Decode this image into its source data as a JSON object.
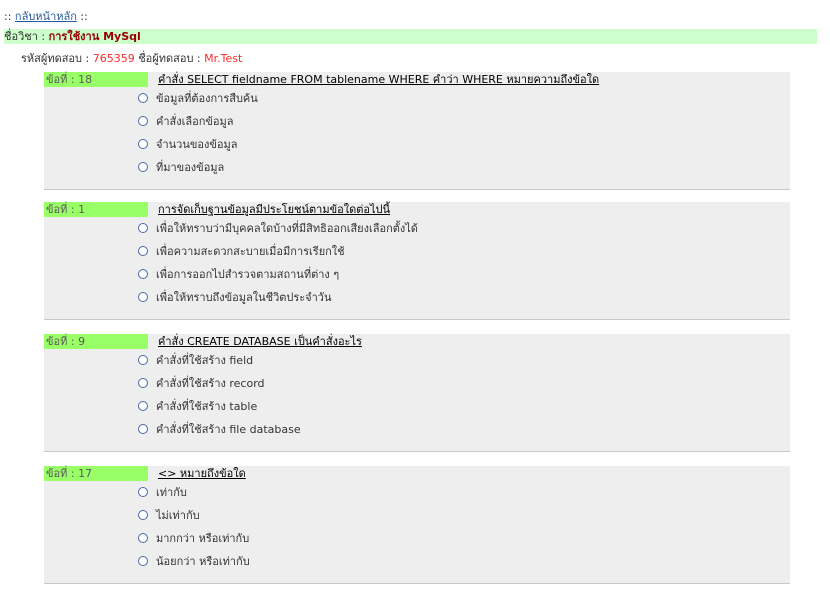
{
  "nav": {
    "prefix": ":: ",
    "home_link": "กลับหน้าหลัก",
    "suffix": " ::"
  },
  "subject": {
    "label": "ชื่อวิชา : ",
    "value": "การใช้งาน MySql"
  },
  "meta": {
    "code_label": "รหัสผู้ทดสอบ : ",
    "code_value": "765359",
    "name_label": " ชื่อผู้ทดสอบ : ",
    "name_value": "Mr.Test"
  },
  "questions": [
    {
      "num": "ข้อที่ : 18",
      "text": "คำสั่ง SELECT fieldname FROM tablename WHERE คำว่า WHERE หมายความถึงข้อใด",
      "choices": [
        "ข้อมูลที่ต้องการสืบค้น",
        "คำสั่งเลือกข้อมูล",
        "จำนวนของข้อมูล",
        "ที่มาของข้อมูล"
      ]
    },
    {
      "num": "ข้อที่ : 1",
      "text": "การจัดเก็บฐานข้อมูลมีประโยชน์ตามข้อใดต่อไปนี้",
      "choices": [
        "เพื่อให้ทราบว่ามีบุคคลใดบ้างที่มีสิทธิออกเสียงเลือกตั้งได้",
        "เพื่อความสะดวกสะบายเมื่อมีการเรียกใช้",
        "เพื่อการออกไปสำรวจตามสถานที่ต่าง ๆ",
        "เพื่อให้ทราบถึงข้อมูลในชีวิตประจำวัน"
      ]
    },
    {
      "num": "ข้อที่ : 9",
      "text": "คำสั่ง CREATE DATABASE เป็นคำสั่งอะไร",
      "choices": [
        "คำสั่งที่ใช้สร้าง field",
        "คำสั่งที่ใช้สร้าง record",
        "คำสั่งที่ใช้สร้าง table",
        "คำสั่งที่ใช้สร้าง file database"
      ]
    },
    {
      "num": "ข้อที่ : 17",
      "text": "<> หมายถึงข้อใด",
      "choices": [
        "เท่ากับ",
        "ไม่เท่ากับ",
        "มากกว่า หรือเท่ากับ",
        "น้อยกว่า หรือเท่ากับ"
      ]
    }
  ]
}
